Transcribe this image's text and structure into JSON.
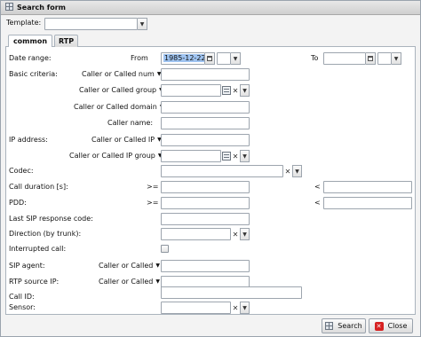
{
  "window": {
    "title": "Search form",
    "icon": "grid-icon"
  },
  "template": {
    "label": "Template:",
    "value": ""
  },
  "tabs": [
    {
      "label": "common"
    },
    {
      "label": "RTP"
    }
  ],
  "form": {
    "date_range": {
      "label": "Date range:",
      "from_label": "From",
      "from_value": "1985-12-22",
      "to_label": "To"
    },
    "basic_criteria": {
      "label": "Basic criteria:"
    },
    "caller_called_num": {
      "label": "Caller or Called num"
    },
    "caller_called_group": {
      "label": "Caller or Called group"
    },
    "caller_called_domain": {
      "label": "Caller or Called domain"
    },
    "caller_name": {
      "label": "Caller name:"
    },
    "ip_address": {
      "label": "IP address:",
      "sub_label": "Caller or Called IP"
    },
    "ip_group": {
      "label": "Caller or Called IP group"
    },
    "codec": {
      "label": "Codec:"
    },
    "call_duration": {
      "label": "Call duration [s]:",
      "ge": ">=",
      "lt": "<"
    },
    "pdd": {
      "label": "PDD:",
      "ge": ">=",
      "lt": "<"
    },
    "last_sip_response": {
      "label": "Last SIP response code:"
    },
    "direction": {
      "label": "Direction (by trunk):"
    },
    "interrupted": {
      "label": "Interrupted call:"
    },
    "sip_agent": {
      "label": "SIP agent:",
      "sub_label": "Caller or Called"
    },
    "rtp_source_ip": {
      "label": "RTP source IP:",
      "sub_label": "Caller or Called"
    },
    "call_id": {
      "label": "Call ID:"
    },
    "sensor": {
      "label": "Sensor:"
    }
  },
  "buttons": {
    "search": "Search",
    "close": "Close"
  },
  "colors": {
    "selection": "#9fc4f1",
    "close_badge": "#d62020"
  }
}
